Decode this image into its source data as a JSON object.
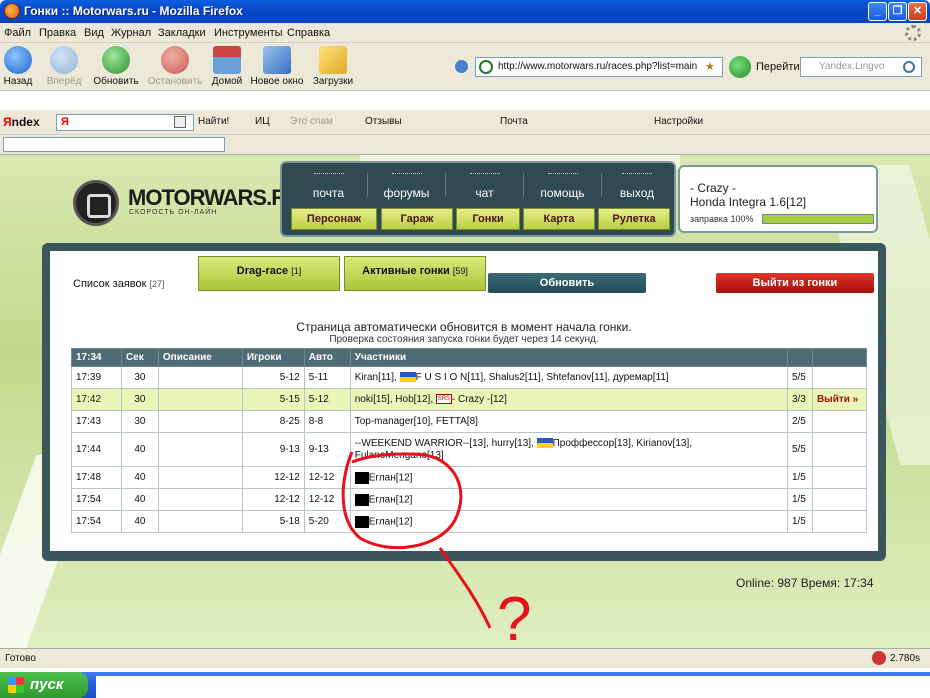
{
  "window": {
    "title": "Гонки :: Motorwars.ru - Mozilla Firefox"
  },
  "menu": [
    "Файл",
    "Правка",
    "Вид",
    "Журнал",
    "Закладки",
    "Инструменты",
    "Справка"
  ],
  "nav": {
    "back": "Назад",
    "forward": "Вперёд",
    "reload": "Обновить",
    "stop": "Остановить",
    "home": "Домой",
    "new_window": "Новое окно",
    "downloads": "Загрузки",
    "url": "http://www.motorwars.ru/races.php?list=main",
    "go": "Перейти",
    "search_placeholder": "Yandex.Lingvo"
  },
  "yabar": {
    "logo_y": "Я",
    "logo_rest": "ndex",
    "ya": "Я",
    "find": "Найти!",
    "ic": "ИЦ",
    "spam": "Это спам",
    "reviews": "Отзывы",
    "mail": "Почта",
    "settings": "Настройки"
  },
  "site": {
    "logo": "MOTORWARS.RU",
    "slogan": "СКОРОСТЬ ОН-ЛАЙН",
    "topnav": [
      "почта",
      "форумы",
      "чат",
      "помощь",
      "выход"
    ],
    "subnav": [
      "Персонаж",
      "Гараж",
      "Гонки",
      "Карта",
      "Рулетка"
    ],
    "user": {
      "name": "- Crazy -",
      "car": "Honda Integra 1.6[12]",
      "fuel_label": "заправка 100%",
      "fuel": 1.0
    }
  },
  "races": {
    "list_label": "Список заявок",
    "list_count": "[27]",
    "tab_drag": "Drag-race",
    "tab_drag_count": "[1]",
    "tab_active": "Активные гонки",
    "tab_active_count": "[59]",
    "refresh": "Обновить",
    "leave": "Выйти из гонки",
    "msg1": "Страница автоматически обновится в момент начала гонки.",
    "msg2": "Проверка состояния запуска гонки будет через 14 секунд.",
    "headers": [
      "17:34",
      "Сек",
      "Описание",
      "Игроки",
      "Авто",
      "Участники"
    ],
    "rows": [
      {
        "time": "17:39",
        "sec": "30",
        "desc": "",
        "players": "5-12",
        "auto": "5-11",
        "count": "5/5"
      },
      {
        "time": "17:42",
        "sec": "30",
        "desc": "",
        "players": "5-15",
        "auto": "5-12",
        "count": "3/3",
        "action": "Выйти »"
      },
      {
        "time": "17:43",
        "sec": "30",
        "desc": "",
        "players": "8-25",
        "auto": "8-8",
        "count": "2/5"
      },
      {
        "time": "17:44",
        "sec": "40",
        "desc": "",
        "players": "9-13",
        "auto": "9-13",
        "count": "5/5"
      },
      {
        "time": "17:48",
        "sec": "40",
        "desc": "",
        "players": "12-12",
        "auto": "12-12",
        "count": "1/5"
      },
      {
        "time": "17:54",
        "sec": "40",
        "desc": "",
        "players": "12-12",
        "auto": "12-12",
        "count": "1/5"
      },
      {
        "time": "17:54",
        "sec": "40",
        "desc": "",
        "players": "5-18",
        "auto": "5-20",
        "count": "1/5"
      }
    ],
    "participants": {
      "r0": [
        "Kiran[11],",
        "F U S I O N[11], Shalus2[11], Shtefanov[11], дуремар[11]"
      ],
      "r1": [
        "noki[15], Hob[12],",
        "SRS",
        "- Crazy -[12]"
      ],
      "r2": "Top-manager[10], FETTA[8]",
      "r3": [
        "--WEEKEND WARRIOR--[13], hurry[13],",
        "Проффессор[13], Kirianov[13],",
        "FulanoMengano[13]"
      ],
      "r4": "Еглан[12]",
      "r5": "Еглан[12]",
      "r6": "Еглан[12]"
    },
    "online": "Online: 987",
    "time": "Время: 17:34"
  },
  "status": {
    "text": "Готово",
    "timer": "2.780s"
  },
  "taskbar": {
    "start": "пуск"
  },
  "annotation": {
    "mark": "?",
    "color": "#e8101a"
  }
}
